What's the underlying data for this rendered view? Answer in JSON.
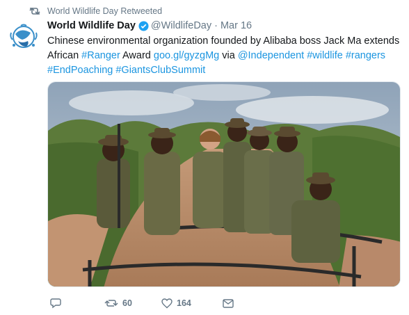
{
  "retweet_header": {
    "text": "World Wildlife Day Retweeted",
    "icon": "retweet-icon"
  },
  "tweet": {
    "author_name": "World Wildlife Day",
    "handle": "@WildlifeDay",
    "separator": "·",
    "time": "Mar 16",
    "verified": true,
    "line1": "Chinese environmental organization founded by Alibaba boss Jack Ma extends",
    "line2_prefix": "African ",
    "hashtag_ranger": "#Ranger",
    "line2_award": " Award ",
    "short_link": "goo.gl/gyzgMg",
    "via": " via ",
    "mention": "@Independent",
    "sp1": " ",
    "hashtag_wildlife": "#wildlife",
    "sp2": " ",
    "hashtag_rangers": "#rangers",
    "hashtag_endpoaching": "#EndPoaching",
    "sp3": " ",
    "hashtag_giantsclub": "#GiantsClubSummit",
    "image_description_icon": "rangers-photo"
  },
  "actions": {
    "reply_icon": "reply-icon",
    "retweet_icon": "retweet-icon",
    "retweet_count": "60",
    "like_icon": "heart-icon",
    "like_count": "164",
    "dm_icon": "envelope-icon"
  },
  "colors": {
    "link": "#1b95e0",
    "secondary_text": "#657786",
    "verified": "#1da1f2"
  }
}
